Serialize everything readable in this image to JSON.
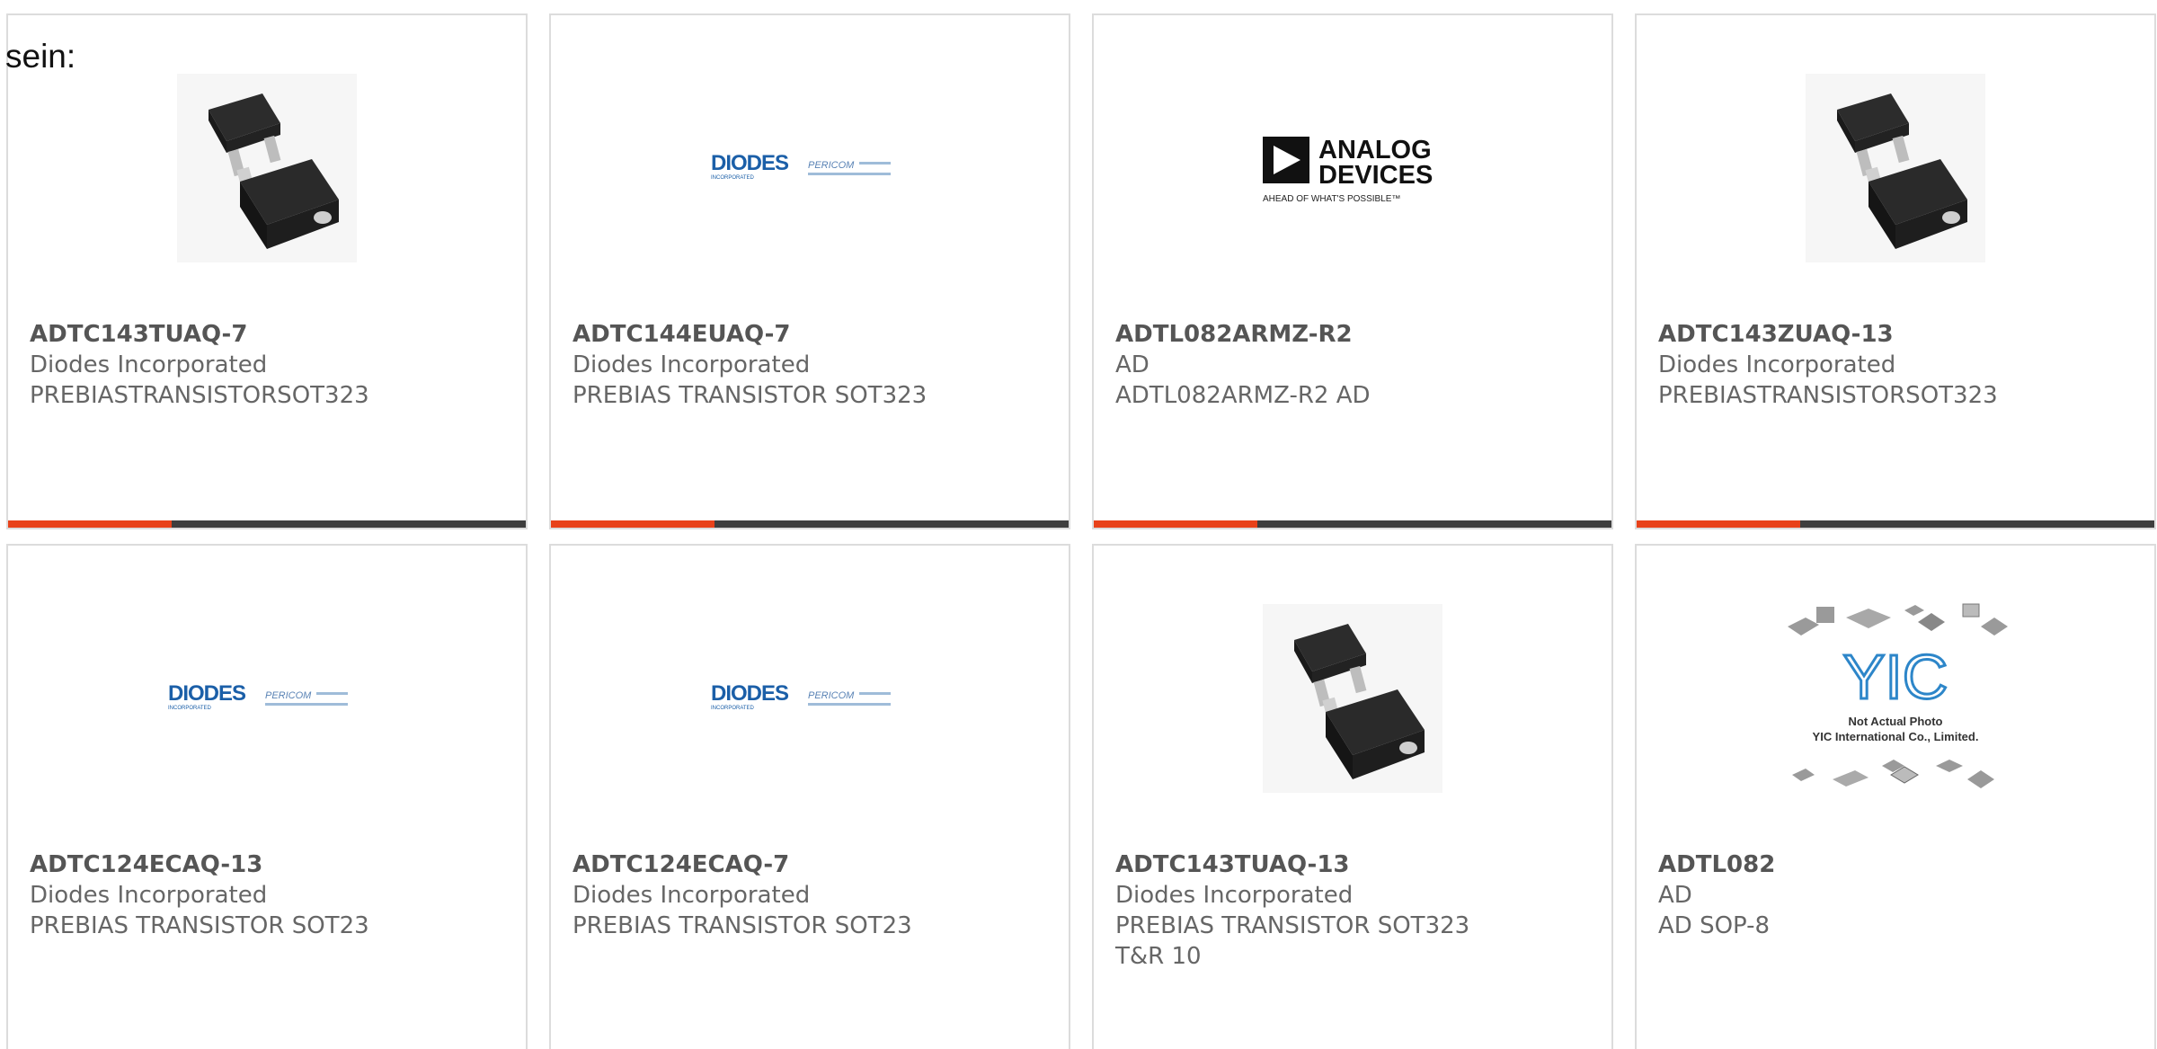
{
  "intro_text": "sein:",
  "colors": {
    "accent": "#e8421a",
    "bar": "#3e3e3e",
    "diodes_blue": "#1b5fa8",
    "text": "#666666"
  },
  "products": [
    {
      "part": "ADTC143TUAQ-7",
      "maker": "Diodes Incorporated",
      "desc": "PREBIASTRANSISTORSOT323",
      "desc2": "",
      "image": "sot323-chip"
    },
    {
      "part": "ADTC144EUAQ-7",
      "maker": "Diodes Incorporated",
      "desc": "PREBIAS TRANSISTOR SOT323",
      "desc2": "",
      "image": "diodes-pericom-logo"
    },
    {
      "part": "ADTL082ARMZ-R2",
      "maker": "AD",
      "desc": "ADTL082ARMZ-R2 AD",
      "desc2": "",
      "image": "analog-devices-logo"
    },
    {
      "part": "ADTC143ZUAQ-13",
      "maker": "Diodes Incorporated",
      "desc": "PREBIASTRANSISTORSOT323",
      "desc2": "",
      "image": "sot323-chip"
    },
    {
      "part": "ADTC124ECAQ-13",
      "maker": "Diodes Incorporated",
      "desc": "PREBIAS TRANSISTOR SOT23",
      "desc2": "",
      "image": "diodes-pericom-logo"
    },
    {
      "part": "ADTC124ECAQ-7",
      "maker": "Diodes Incorporated",
      "desc": "PREBIAS TRANSISTOR SOT23",
      "desc2": "",
      "image": "diodes-pericom-logo"
    },
    {
      "part": "ADTC143TUAQ-13",
      "maker": "Diodes Incorporated",
      "desc": "PREBIAS TRANSISTOR SOT323",
      "desc2": "T&R 10",
      "image": "sot323-chip"
    },
    {
      "part": "ADTL082",
      "maker": "AD",
      "desc": "AD SOP-8",
      "desc2": "",
      "image": "yic-placeholder"
    }
  ],
  "logos": {
    "diodes": "DIODES",
    "diodes_sub": "INCORPORATED",
    "pericom": "PERICOM",
    "analog_line1": "ANALOG",
    "analog_line2": "DEVICES",
    "analog_tagline": "AHEAD OF WHAT'S POSSIBLE™",
    "yic_mark": "YIC",
    "yic_line1": "Not Actual Photo",
    "yic_line2": "YIC International Co., Limited."
  }
}
